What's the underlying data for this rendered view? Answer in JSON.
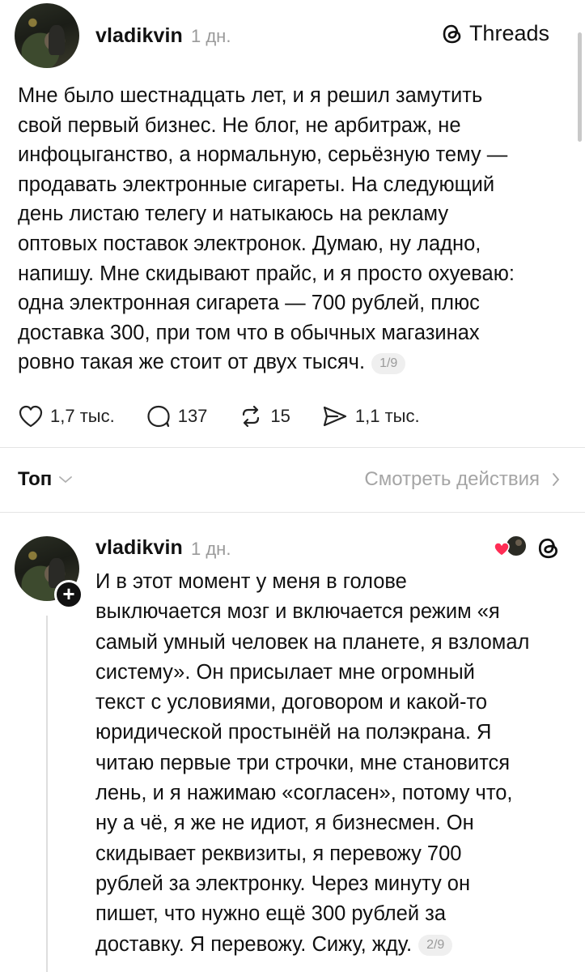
{
  "post": {
    "username": "vladikvin",
    "time": "1 дн.",
    "threads_label": "Threads",
    "text": "Мне было шестнадцать лет, и я решил замутить\nсвой первый бизнес. Не блог, не арбитраж, не\nинфоцыганство, а нормальную, серьёзную тему —\nпродавать электронные сигареты. На следующий\nдень листаю телегу и натыкаюсь на рекламу\nоптовых поставок электронок. Думаю, ну ладно,\nнапишу. Мне скидывают прайс, и я просто охуеваю:\nодна электронная сигарета — 700 рублей, плюс\nдоставка 300, при том что в обычных магазинах\nровно такая же стоит от двух тысяч.",
    "page": "1/9",
    "likes": "1,7 тыс.",
    "comments": "137",
    "reposts": "15",
    "shares": "1,1 тыс."
  },
  "replies_header": {
    "sort_label": "Топ",
    "activity_label": "Смотреть действия"
  },
  "reply": {
    "username": "vladikvin",
    "time": "1 дн.",
    "text": "И в этот момент у меня в голове\nвыключается мозг и включается режим «я\nсамый умный человек на планете, я взломал\nсистему». Он присылает мне огромный\nтекст с условиями, договором и какой-то\nюридической простынёй на полэкрана. Я\nчитаю первые три строчки, мне становится\nлень, и я нажимаю «согласен», потому что,\nну а чё, я же не идиот, я бизнесмен. Он\nскидывает реквизиты, я перевожу 700\nрублей за электронку. Через минуту он\nпишет, что нужно ещё 300 рублей за\nдоставку. Я перевожу. Сижу, жду.",
    "page": "2/9"
  },
  "icons": {
    "like": "heart-icon",
    "comment": "comment-bubble-icon",
    "repost": "repost-icon",
    "share": "send-icon",
    "threads": "threads-logo-icon",
    "sort": "chevron-down-icon",
    "activity": "chevron-right-icon",
    "follow": "plus-icon"
  },
  "colors": {
    "text": "#111111",
    "muted": "#9a9a9a",
    "liked": "#ff2d55"
  }
}
